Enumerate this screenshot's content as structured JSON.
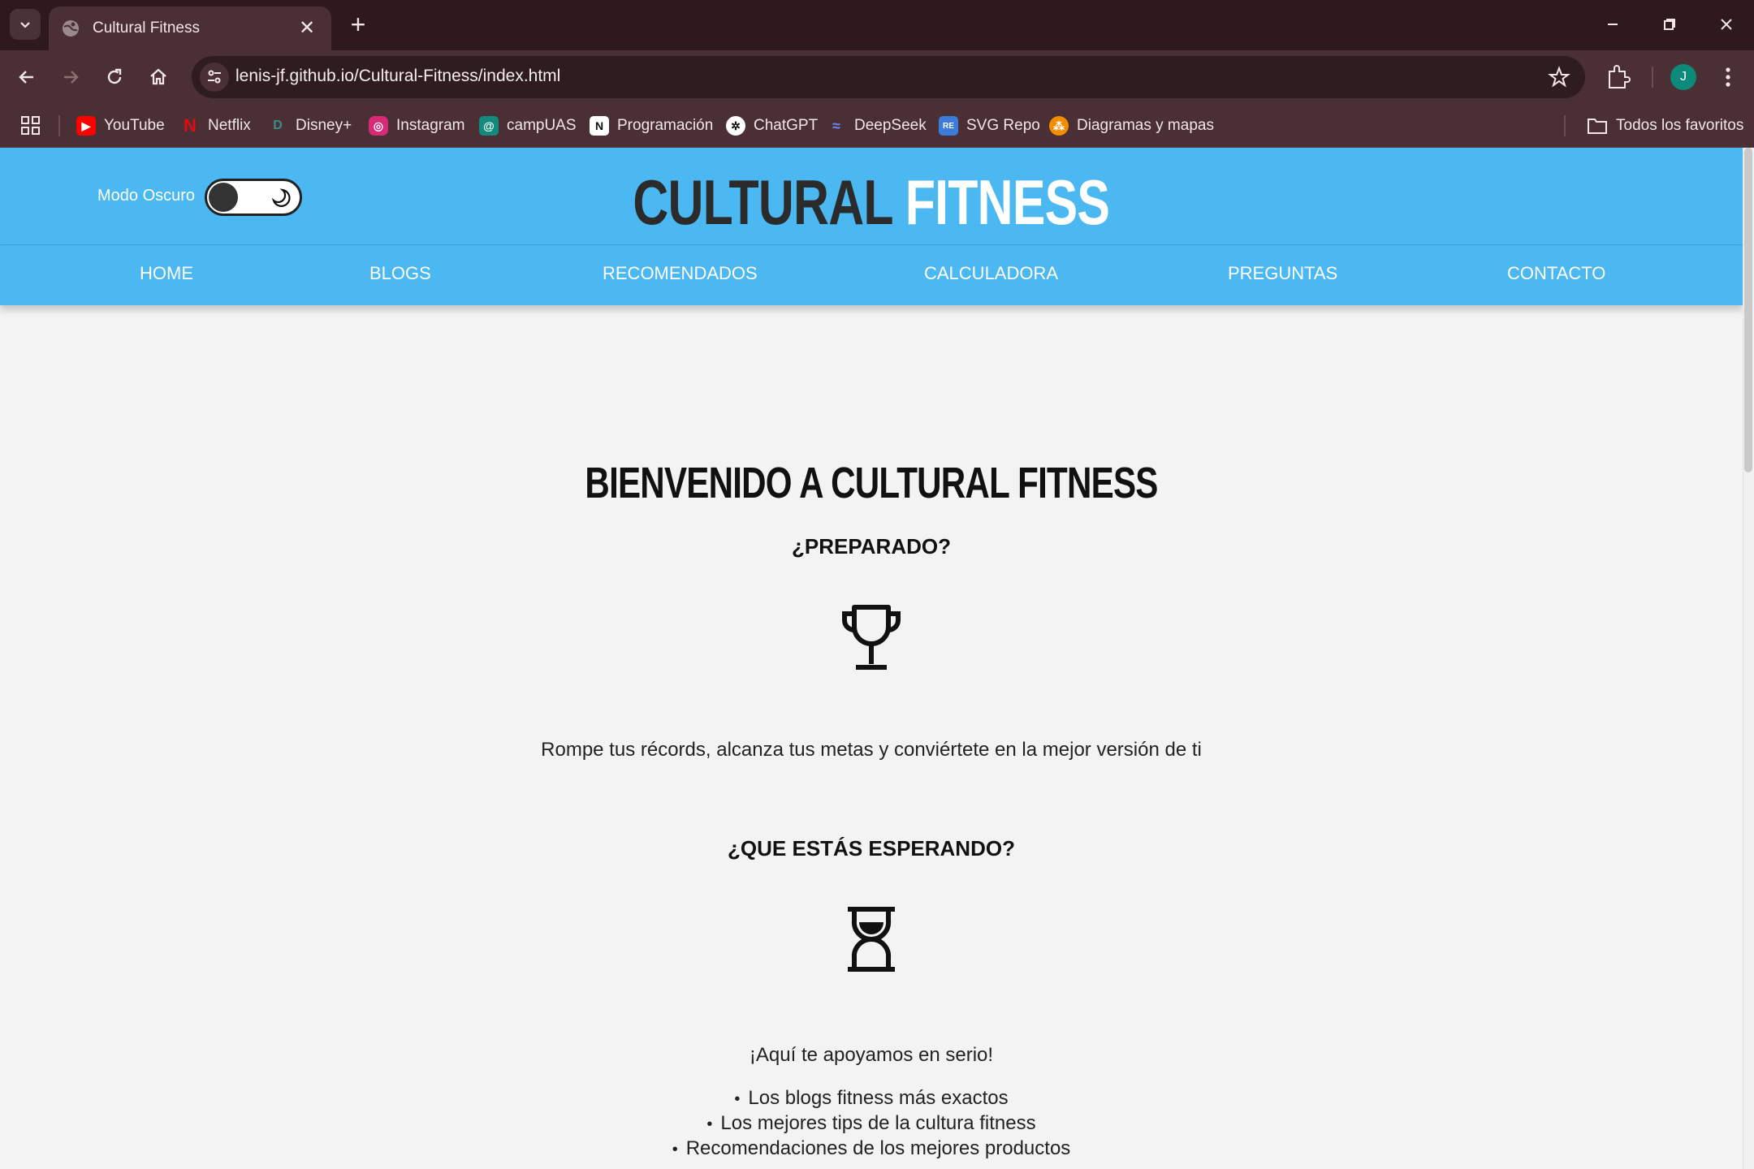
{
  "browser": {
    "tab_title": "Cultural Fitness",
    "tab_close": "✕",
    "new_tab": "+",
    "url": "lenis-jf.github.io/Cultural-Fitness/index.html",
    "avatar_letter": "J",
    "bookmarks": [
      {
        "label": "YouTube",
        "icon": "youtube-icon",
        "color": "#ff0000"
      },
      {
        "label": "Netflix",
        "icon": "netflix-icon",
        "color": "#e50914"
      },
      {
        "label": "Disney+",
        "icon": "disney-icon",
        "color": "#1f6f6b"
      },
      {
        "label": "Instagram",
        "icon": "instagram-icon",
        "color": "#d62976"
      },
      {
        "label": "campUAS",
        "icon": "campuas-icon",
        "color": "#128a7e"
      },
      {
        "label": "Programación",
        "icon": "notion-icon",
        "color": "#ffffff"
      },
      {
        "label": "ChatGPT",
        "icon": "chatgpt-icon",
        "color": "#ffffff"
      },
      {
        "label": "DeepSeek",
        "icon": "deepseek-icon",
        "color": "#4d6bfe"
      },
      {
        "label": "SVG Repo",
        "icon": "svgrepo-icon",
        "color": "#3d7bd9"
      },
      {
        "label": "Diagramas y mapas",
        "icon": "diagrams-icon",
        "color": "#f28c00"
      }
    ],
    "all_bookmarks": "Todos los favoritos"
  },
  "header": {
    "dark_mode_label": "Modo Oscuro",
    "brand_part1": "CULTURAL",
    "brand_part2": "FITNESS",
    "accent_color": "#4bb8f1"
  },
  "nav": {
    "items": [
      "HOME",
      "BLOGS",
      "RECOMENDADOS",
      "CALCULADORA",
      "PREGUNTAS",
      "CONTACTO"
    ]
  },
  "main": {
    "title": "BIENVENIDO A CULTURAL FITNESS",
    "subtitle_1": "¿PREPARADO?",
    "text_1": "Rompe tus récords, alcanza tus metas y conviértete en la mejor versión de ti",
    "subtitle_2": "¿QUE ESTÁS ESPERANDO?",
    "text_2": "¡Aquí te apoyamos en serio!",
    "list": [
      "Los blogs fitness más exactos",
      "Los mejores tips de la cultura fitness",
      "Recomendaciones de los mejores productos"
    ]
  }
}
